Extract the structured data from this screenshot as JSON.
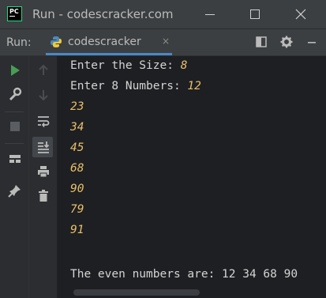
{
  "window": {
    "title": "Run - codescracker.com",
    "logo_text": "PC"
  },
  "toolbar": {
    "run_label": "Run:",
    "tab_label": "codescracker",
    "tab_close": "×"
  },
  "console": {
    "lines": [
      {
        "prompt": "Enter the Size: ",
        "input": "8"
      },
      {
        "prompt": "Enter 8 Numbers: ",
        "input": "12"
      },
      {
        "prompt": "",
        "input": "23"
      },
      {
        "prompt": "",
        "input": "34"
      },
      {
        "prompt": "",
        "input": "45"
      },
      {
        "prompt": "",
        "input": "68"
      },
      {
        "prompt": "",
        "input": "90"
      },
      {
        "prompt": "",
        "input": "79"
      },
      {
        "prompt": "",
        "input": "91"
      }
    ],
    "result": "The even numbers are: 12 34 68 90"
  },
  "colors": {
    "accent": "#4a88c7",
    "input_text": "#e8bf6a",
    "run_green": "#499c54"
  }
}
